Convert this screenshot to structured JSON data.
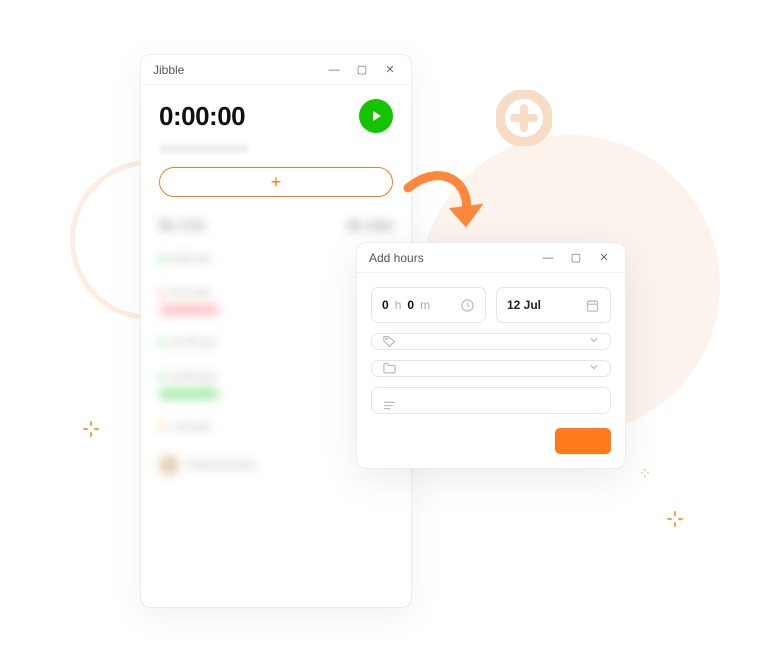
{
  "tracker": {
    "title": "Jibble",
    "timer": "0:00:00",
    "summary": {
      "left": "5h 17m",
      "right": "4h 12m"
    },
    "entries": [
      {
        "time": "9:00 am",
        "color": "green"
      },
      {
        "time": "9:12 am",
        "color": "red",
        "pill": "red"
      },
      {
        "time": "11:35 am",
        "color": "green"
      },
      {
        "time": "12:00 pm",
        "color": "green",
        "pill": "green"
      },
      {
        "time": "1:12 pm",
        "color": "orange"
      }
    ]
  },
  "dialog": {
    "title": "Add hours",
    "duration": {
      "hours": "0",
      "h_unit": "h",
      "minutes": "0",
      "m_unit": "m"
    },
    "date": "12 Jul"
  },
  "colors": {
    "accent": "#ff7a1a",
    "play": "#14c400"
  }
}
